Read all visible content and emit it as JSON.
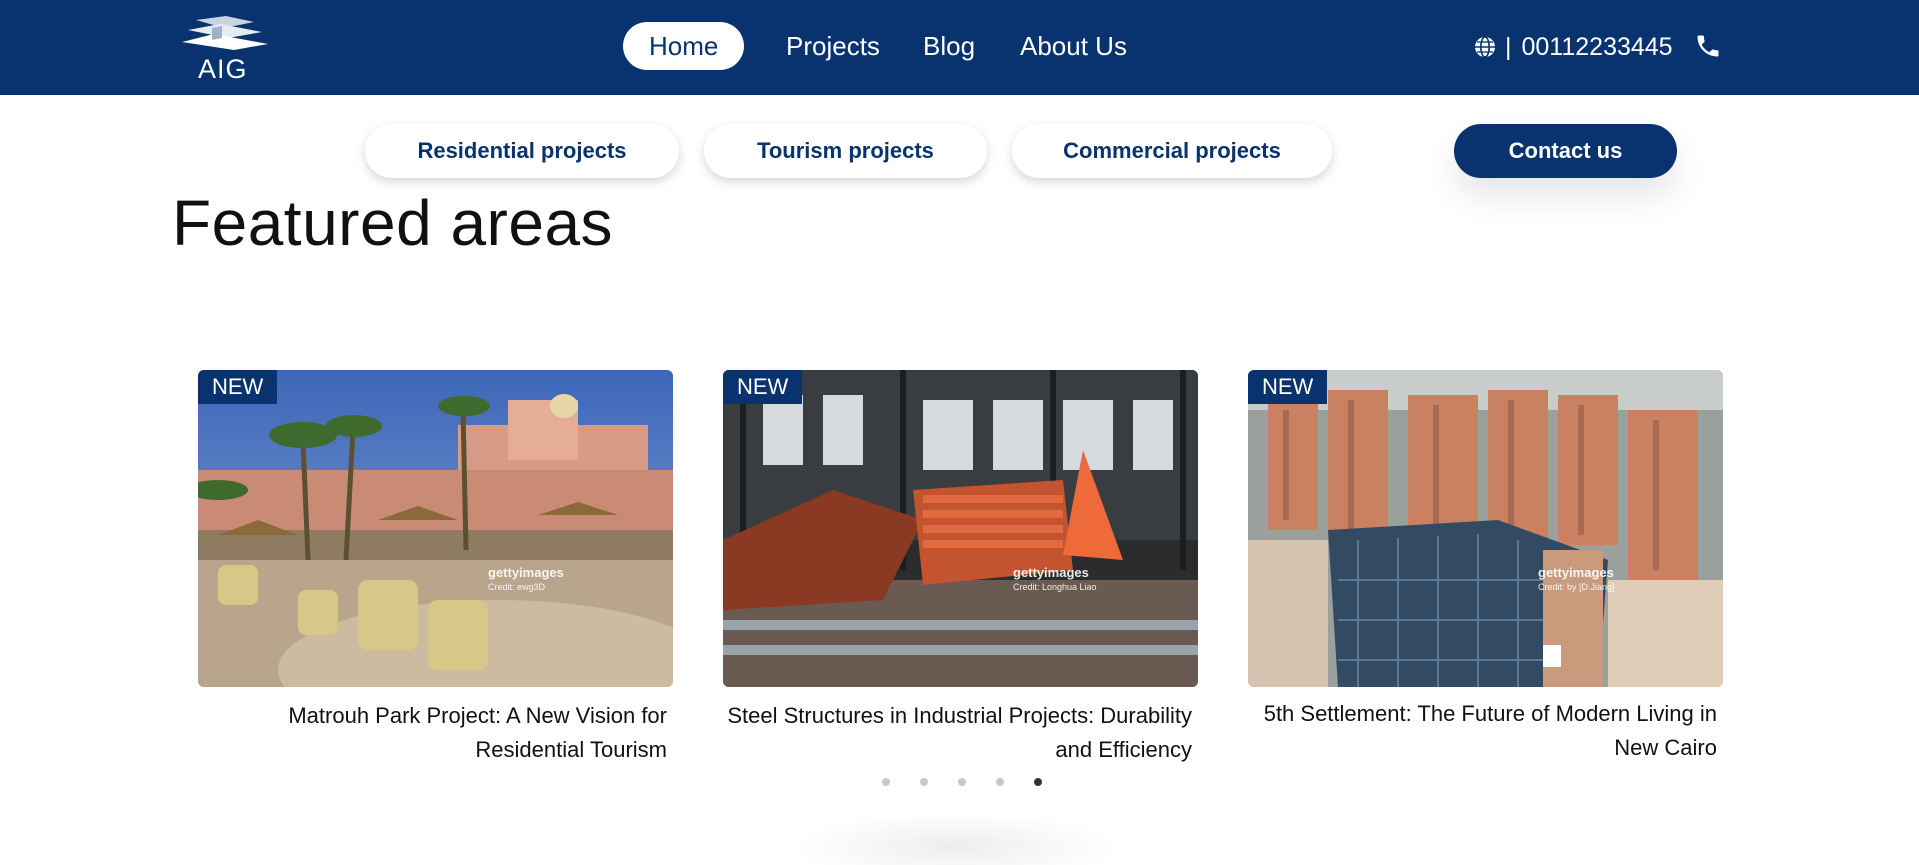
{
  "logo": {
    "text": "AIG"
  },
  "nav": {
    "items": [
      {
        "label": "Home",
        "active": true
      },
      {
        "label": "Projects",
        "active": false
      },
      {
        "label": "Blog",
        "active": false
      },
      {
        "label": "About Us",
        "active": false
      }
    ]
  },
  "contact": {
    "separator": "|",
    "phone": "00112233445",
    "globe_icon": "globe-icon",
    "phone_icon": "phone-icon"
  },
  "categories": [
    {
      "label": "Residential projects"
    },
    {
      "label": "Tourism projects"
    },
    {
      "label": "Commercial projects"
    }
  ],
  "contact_button": {
    "label": "Contact us"
  },
  "section": {
    "title": "Featured areas"
  },
  "cards": [
    {
      "badge": "NEW",
      "watermark_brand": "gettyimages",
      "watermark_credit": "Credit: ewg3D",
      "title": "Matrouh Park Project: A New Vision for Residential Tourism"
    },
    {
      "badge": "NEW",
      "watermark_brand": "gettyimages",
      "watermark_credit": "Credit: Longhua Liao",
      "title": "Steel Structures in Industrial Projects: Durability and Efficiency"
    },
    {
      "badge": "NEW",
      "watermark_brand": "gettyimages",
      "watermark_credit": "Credit: by [D.Jiang]",
      "title": "5th Settlement: The Future of Modern Living in New Cairo"
    }
  ],
  "carousel": {
    "dot_count": 5,
    "active_index": 4
  },
  "colors": {
    "brand_navy": "#08336f",
    "white": "#ffffff",
    "dot_inactive": "#c8c8c8",
    "dot_active": "#333333"
  }
}
